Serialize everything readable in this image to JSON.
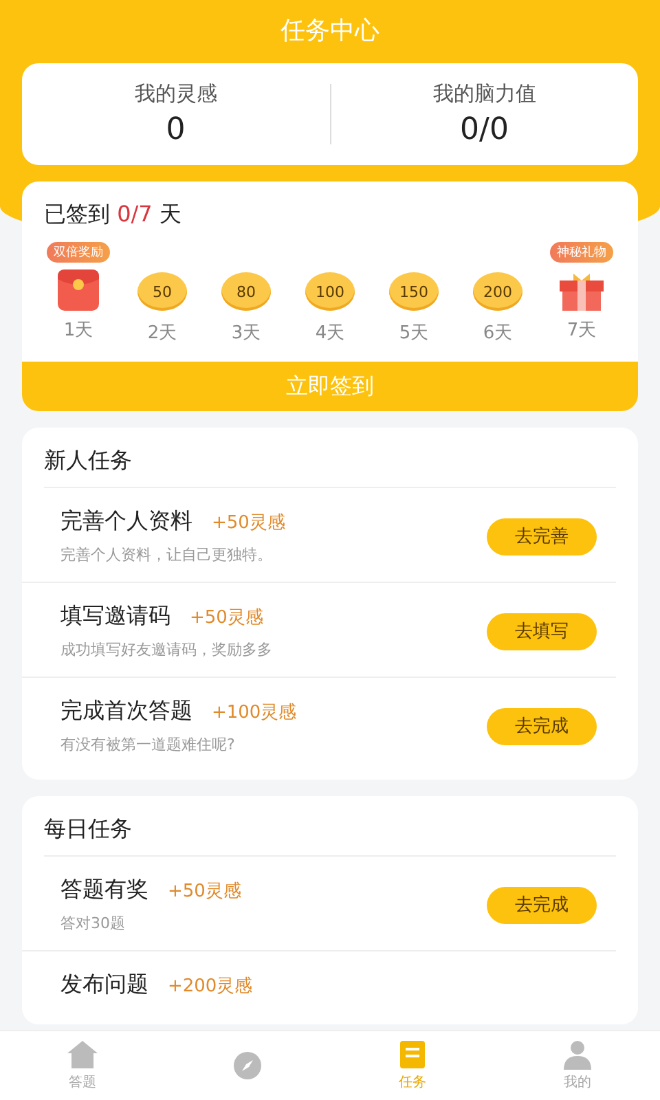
{
  "header": {
    "title": "任务中心"
  },
  "stats": [
    {
      "label": "我的灵感",
      "value": "0"
    },
    {
      "label": "我的脑力值",
      "value": "0/0"
    }
  ],
  "checkin": {
    "prefix": "已签到",
    "count": "0/7",
    "suffix": "天",
    "days": [
      {
        "kind": "redpacket",
        "badge": "双倍奖励",
        "label": "1天"
      },
      {
        "kind": "coin",
        "amount": "50",
        "label": "2天"
      },
      {
        "kind": "coin",
        "amount": "80",
        "label": "3天"
      },
      {
        "kind": "coin",
        "amount": "100",
        "label": "4天"
      },
      {
        "kind": "coin",
        "amount": "150",
        "label": "5天"
      },
      {
        "kind": "coin",
        "amount": "200",
        "label": "6天"
      },
      {
        "kind": "gift",
        "badge": "神秘礼物",
        "label": "7天"
      }
    ],
    "button": "立即签到"
  },
  "sections": [
    {
      "title": "新人任务",
      "tasks": [
        {
          "name": "完善个人资料",
          "reward": "+50灵感",
          "desc": "完善个人资料，让自己更独特。",
          "button": "去完善"
        },
        {
          "name": "填写邀请码",
          "reward": "+50灵感",
          "desc": "成功填写好友邀请码，奖励多多",
          "button": "去填写"
        },
        {
          "name": "完成首次答题",
          "reward": "+100灵感",
          "desc": "有没有被第一道题难住呢?",
          "button": "去完成"
        }
      ]
    },
    {
      "title": "每日任务",
      "tasks": [
        {
          "name": "答题有奖",
          "reward": "+50灵感",
          "desc": "答对30题",
          "button": "去完成"
        },
        {
          "name": "发布问题",
          "reward": "+200灵感"
        }
      ]
    }
  ],
  "tabbar": [
    {
      "kind": "home",
      "label": "答题",
      "selected": false
    },
    {
      "kind": "compass",
      "selected": false
    },
    {
      "kind": "task",
      "label": "任务",
      "selected": true
    },
    {
      "kind": "person",
      "label": "我的",
      "selected": false
    }
  ]
}
